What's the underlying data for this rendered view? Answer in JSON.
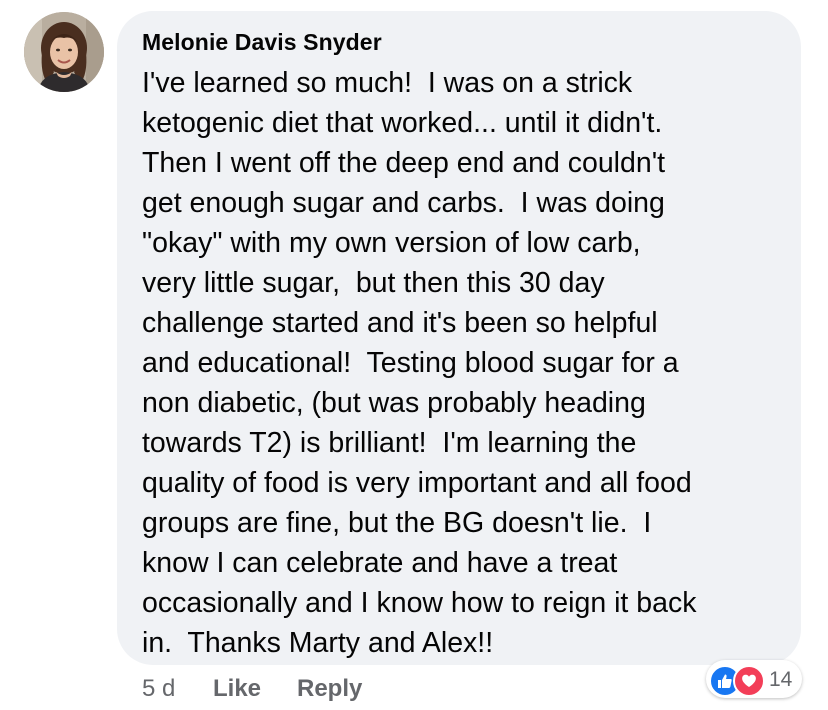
{
  "comment": {
    "author": "Melonie Davis Snyder",
    "lines": [
      "I've learned so much!  I was on a strick",
      "ketogenic diet that worked... until it didn't.",
      "Then I went off the deep end and couldn't",
      "get enough sugar and carbs.  I was doing",
      "\"okay\" with my own version of low carb,",
      "very little sugar,  but then this 30 day",
      "challenge started and it's been so helpful",
      "and educational!  Testing blood sugar for a",
      "non diabetic, (but was probably heading",
      "towards T2) is brilliant!  I'm learning the",
      "quality of food is very important and all food",
      "groups are fine, but the BG doesn't lie.  I",
      "know I can celebrate and have a treat",
      "occasionally and I know how to reign it back",
      "in.  Thanks Marty and Alex!!"
    ]
  },
  "actions": {
    "time": "5 d",
    "like": "Like",
    "reply": "Reply"
  },
  "reactions": {
    "icons": [
      "like-icon",
      "love-icon"
    ],
    "count": "14",
    "colors": {
      "like": "#1877f2",
      "love": "#f33e58"
    }
  },
  "colors": {
    "bubble": "#f0f2f5",
    "text": "#050505",
    "secondary": "#65676b"
  }
}
